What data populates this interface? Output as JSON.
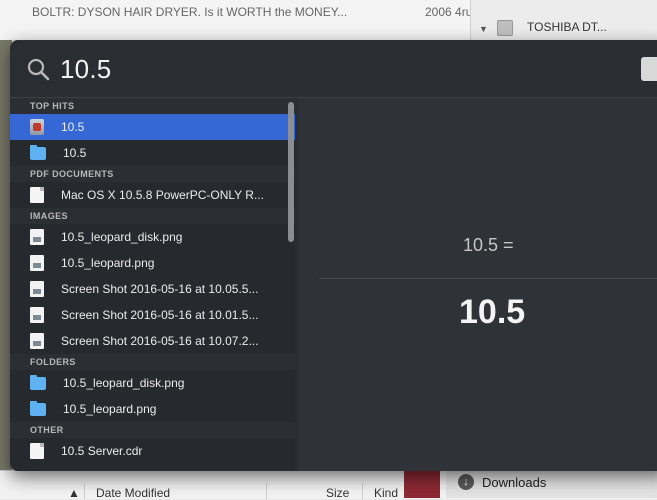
{
  "background": {
    "top_left_title": "BOLTR: DYSON HAIR DRYER. Is it WORTH the MONEY...",
    "top_date": "2006 4ru",
    "drive_name": "TOSHIBA DT...",
    "columns": [
      "Date Modified",
      "Size",
      "Kind"
    ],
    "downloads_label": "Downloads"
  },
  "spotlight": {
    "query": "10.5",
    "sections": [
      {
        "title": "TOP HITS",
        "items": [
          {
            "label": "10.5",
            "icon": "app-icon",
            "selected": true
          },
          {
            "label": "10.5",
            "icon": "folder-icon"
          }
        ]
      },
      {
        "title": "PDF DOCUMENTS",
        "items": [
          {
            "label": "Mac OS X 10.5.8 PowerPC-ONLY R...",
            "icon": "document-icon"
          }
        ]
      },
      {
        "title": "IMAGES",
        "items": [
          {
            "label": "10.5_leopard_disk.png",
            "icon": "image-icon"
          },
          {
            "label": "10.5_leopard.png",
            "icon": "image-icon"
          },
          {
            "label": "Screen Shot 2016-05-16 at 10.05.5...",
            "icon": "image-icon"
          },
          {
            "label": "Screen Shot 2016-05-16 at 10.01.5...",
            "icon": "image-icon"
          },
          {
            "label": "Screen Shot 2016-05-16 at 10.07.2...",
            "icon": "image-icon"
          }
        ]
      },
      {
        "title": "FOLDERS",
        "items": [
          {
            "label": "10.5_leopard_disk.png",
            "icon": "folder-icon"
          },
          {
            "label": "10.5_leopard.png",
            "icon": "folder-icon"
          }
        ]
      },
      {
        "title": "OTHER",
        "items": [
          {
            "label": "10.5 Server.cdr",
            "icon": "document-icon"
          }
        ]
      }
    ],
    "preview": {
      "expression": "10.5 =",
      "result": "10.5"
    }
  }
}
